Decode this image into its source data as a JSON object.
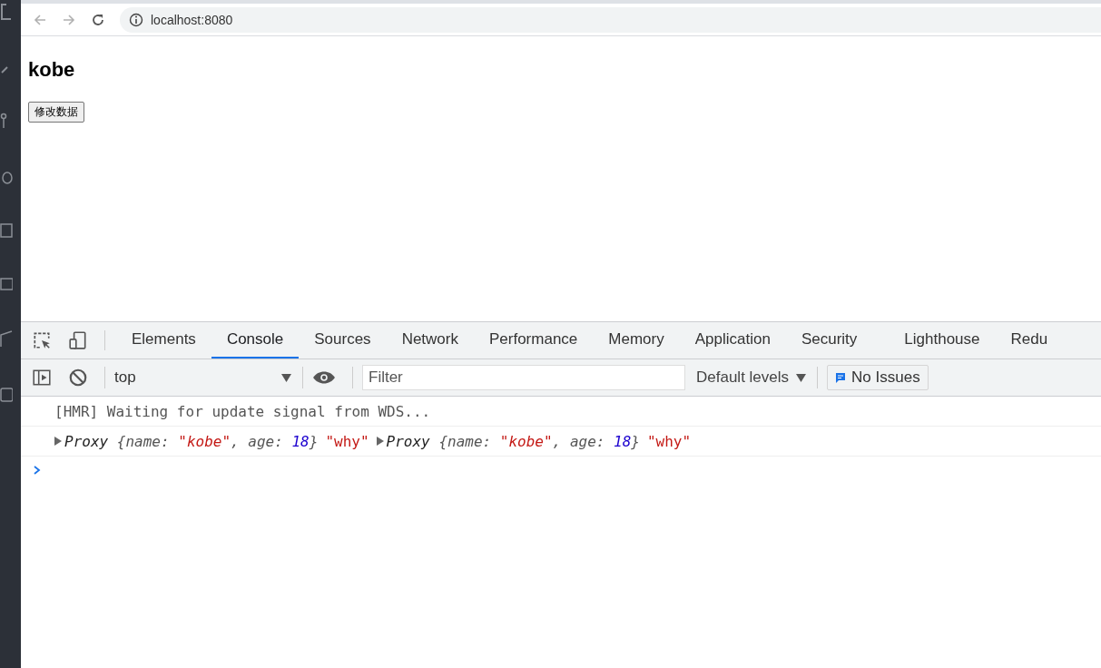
{
  "browser": {
    "url": "localhost:8080"
  },
  "page": {
    "heading": "kobe",
    "button": "修改数据"
  },
  "devtools": {
    "tabs": [
      {
        "label": "Elements",
        "selected": false
      },
      {
        "label": "Console",
        "selected": true
      },
      {
        "label": "Sources",
        "selected": false
      },
      {
        "label": "Network",
        "selected": false
      },
      {
        "label": "Performance",
        "selected": false
      },
      {
        "label": "Memory",
        "selected": false
      },
      {
        "label": "Application",
        "selected": false
      },
      {
        "label": "Security",
        "selected": false
      },
      {
        "label": "Lighthouse",
        "selected": false
      },
      {
        "label": "Redu",
        "selected": false
      }
    ],
    "context": "top",
    "filter": {
      "placeholder": "Filter"
    },
    "levels": "Default levels",
    "issues": "No Issues",
    "messages": [
      {
        "items": [
          {
            "kind": "text",
            "parts": [
              {
                "kind": "plain",
                "text": "[HMR] Waiting for update signal from WDS..."
              }
            ]
          }
        ]
      },
      {
        "items": [
          {
            "kind": "object",
            "label": "Proxy",
            "parts": [
              {
                "kind": "plain",
                "text": "{name: "
              },
              {
                "kind": "string",
                "text": "\"kobe\""
              },
              {
                "kind": "plain",
                "text": ", age: "
              },
              {
                "kind": "number",
                "text": "18"
              },
              {
                "kind": "plain",
                "text": "}"
              }
            ]
          },
          {
            "kind": "string",
            "parts": [
              {
                "kind": "string",
                "text": "\"why\""
              }
            ]
          },
          {
            "kind": "object",
            "label": "Proxy",
            "parts": [
              {
                "kind": "plain",
                "text": "{name: "
              },
              {
                "kind": "string",
                "text": "\"kobe\""
              },
              {
                "kind": "plain",
                "text": ", age: "
              },
              {
                "kind": "number",
                "text": "18"
              },
              {
                "kind": "plain",
                "text": "}"
              }
            ]
          },
          {
            "kind": "string",
            "parts": [
              {
                "kind": "string",
                "text": "\"why\""
              }
            ]
          }
        ]
      }
    ]
  }
}
